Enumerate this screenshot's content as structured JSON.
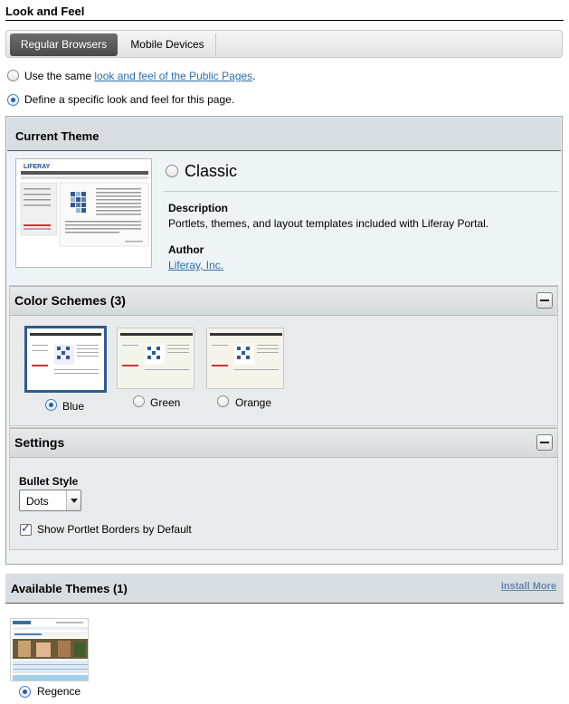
{
  "page": {
    "section_title": "Look and Feel"
  },
  "tabs": [
    {
      "label": "Regular Browsers",
      "active": true
    },
    {
      "label": "Mobile Devices",
      "active": false
    }
  ],
  "options": {
    "same_prefix": "Use the same ",
    "same_link": "look and feel of the Public Pages",
    "same_suffix": ".",
    "specific": "Define a specific look and feel for this page."
  },
  "current_theme": {
    "header": "Current Theme",
    "name": "Classic",
    "description_label": "Description",
    "description": "Portlets, themes, and layout templates included with Liferay Portal.",
    "author_label": "Author",
    "author": "Liferay, Inc.",
    "thumb_logo": "LIFERAY"
  },
  "color_schemes": {
    "header": "Color Schemes (3)",
    "items": [
      {
        "label": "Blue",
        "selected": true
      },
      {
        "label": "Green",
        "selected": false
      },
      {
        "label": "Orange",
        "selected": false
      }
    ]
  },
  "settings": {
    "header": "Settings",
    "bullet_style_label": "Bullet Style",
    "bullet_style_value": "Dots",
    "show_borders_label": "Show Portlet Borders by Default",
    "show_borders_checked": true
  },
  "available_themes": {
    "header": "Available Themes (1)",
    "install_more": "Install More",
    "items": [
      {
        "label": "Regence",
        "selected": true
      }
    ]
  },
  "colors": {
    "accent": "#2b6ea9",
    "selected_border": "#2d5b8f",
    "header_bg": "#d7dde0"
  }
}
